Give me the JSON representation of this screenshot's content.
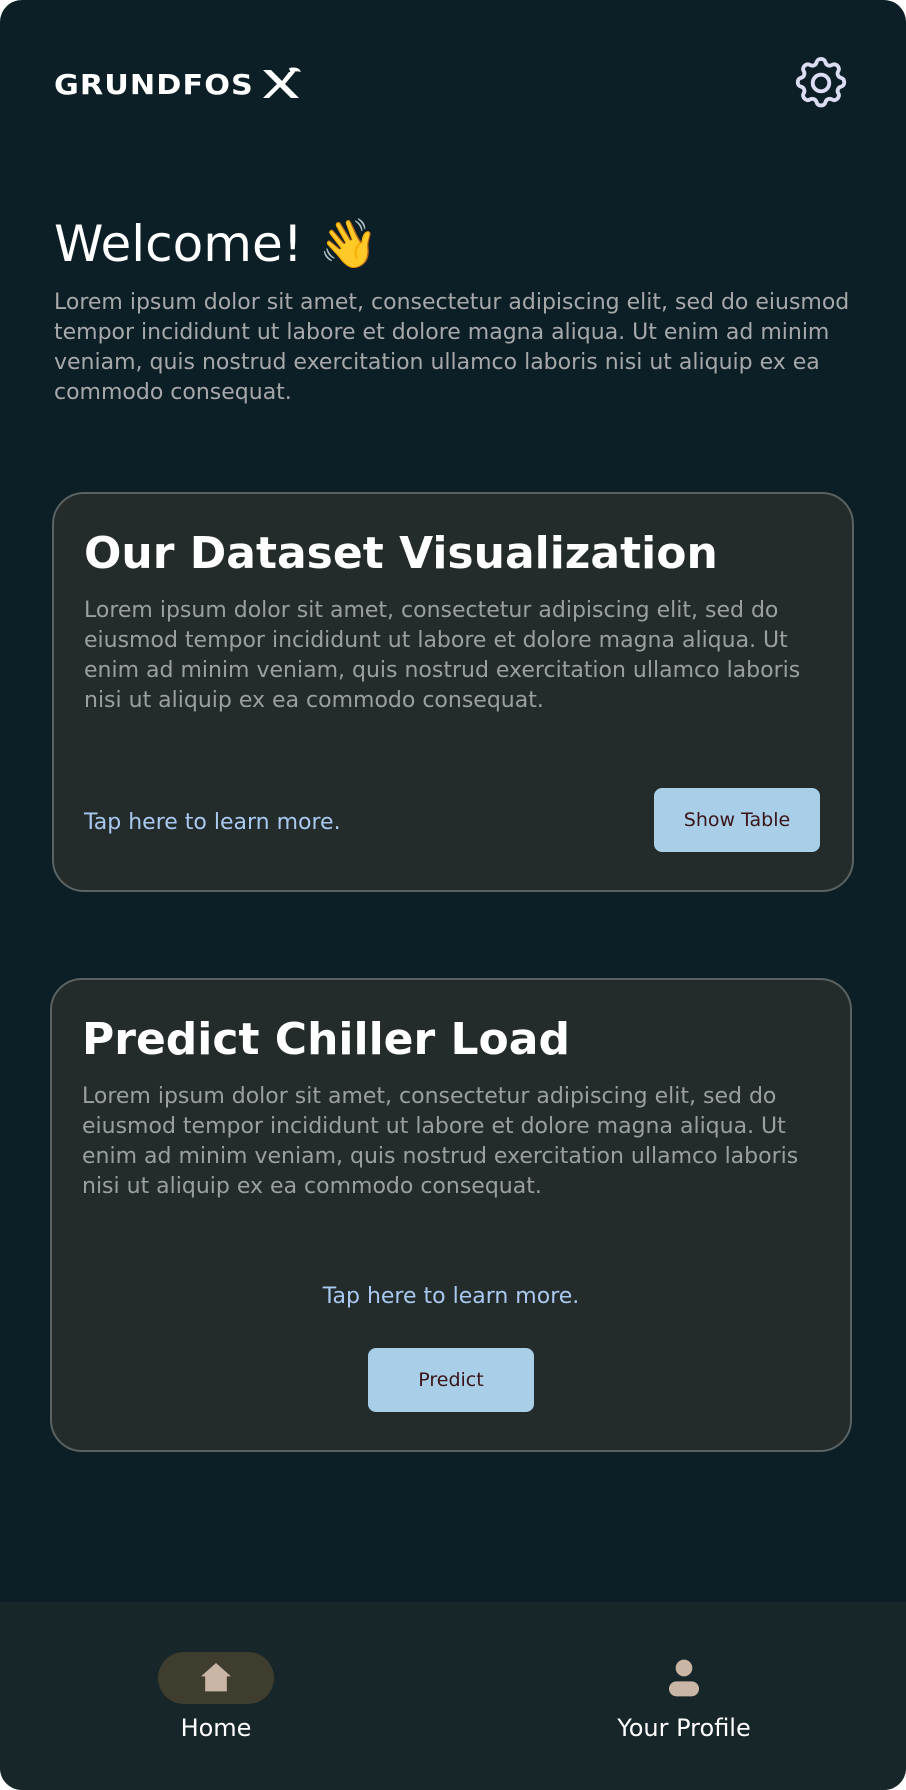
{
  "header": {
    "logo_text": "GRUNDFOS",
    "settings_icon": "gear-icon"
  },
  "welcome": {
    "title": "Welcome!",
    "emoji": "👋",
    "text": "Lorem ipsum dolor sit amet, consectetur adipiscing elit, sed do eiusmod  tempor incididunt ut labore et dolore magna aliqua. Ut enim ad minim  veniam, quis nostrud exercitation ullamco laboris nisi ut aliquip ex ea  commodo consequat."
  },
  "cards": [
    {
      "title": "Our Dataset Visualization",
      "text": "Lorem ipsum dolor sit amet, consectetur adipiscing elit, sed do eiusmod  tempor incididunt ut labore et dolore magna aliqua. Ut enim ad minim  veniam, quis nostrud exercitation ullamco laboris nisi ut aliquip ex ea  commodo consequat.",
      "link": "Tap here to learn more.",
      "button": "Show Table"
    },
    {
      "title": "Predict Chiller Load",
      "text": "Lorem ipsum dolor sit amet, consectetur adipiscing elit, sed do eiusmod  tempor incididunt ut labore et dolore magna aliqua. Ut enim ad minim  veniam, quis nostrud exercitation ullamco laboris nisi ut aliquip ex ea  commodo consequat.",
      "link": "Tap here to learn more.",
      "button": "Predict"
    }
  ],
  "nav": {
    "items": [
      {
        "label": "Home",
        "icon": "home-icon",
        "active": true
      },
      {
        "label": "Your Profile",
        "icon": "user-icon",
        "active": false
      }
    ]
  },
  "colors": {
    "background": "#0c1f26",
    "card": "#232b2b",
    "button": "#a8cee8",
    "link": "#a9c9f0",
    "nav_active_pill": "#3f3d2e"
  }
}
